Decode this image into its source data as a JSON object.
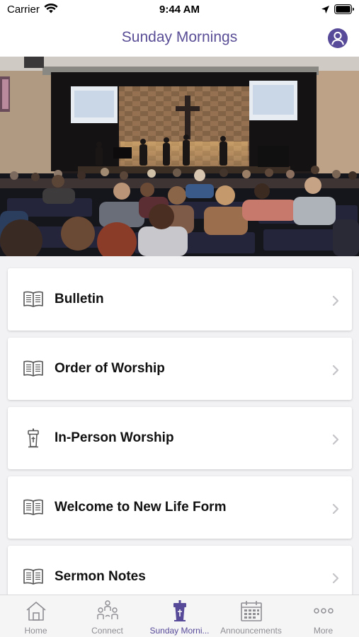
{
  "status_bar": {
    "carrier": "Carrier",
    "time": "9:44 AM"
  },
  "nav": {
    "title": "Sunday Mornings"
  },
  "menu": {
    "items": [
      {
        "label": "Bulletin",
        "icon": "book-icon"
      },
      {
        "label": "Order of Worship",
        "icon": "book-icon"
      },
      {
        "label": "In-Person Worship",
        "icon": "pulpit-icon"
      },
      {
        "label": "Welcome to New Life Form",
        "icon": "book-icon"
      },
      {
        "label": "Sermon Notes",
        "icon": "book-icon"
      }
    ]
  },
  "tabs": [
    {
      "label": "Home",
      "icon": "house-icon",
      "active": false
    },
    {
      "label": "Connect",
      "icon": "people-icon",
      "active": false
    },
    {
      "label": "Sunday Morni...",
      "icon": "pulpit-icon",
      "active": true
    },
    {
      "label": "Announcements",
      "icon": "calendar-icon",
      "active": false
    },
    {
      "label": "More",
      "icon": "more-icon",
      "active": false
    }
  ],
  "colors": {
    "accent": "#574a98",
    "inactive": "#8e8e93",
    "background": "#f2f2f4"
  }
}
